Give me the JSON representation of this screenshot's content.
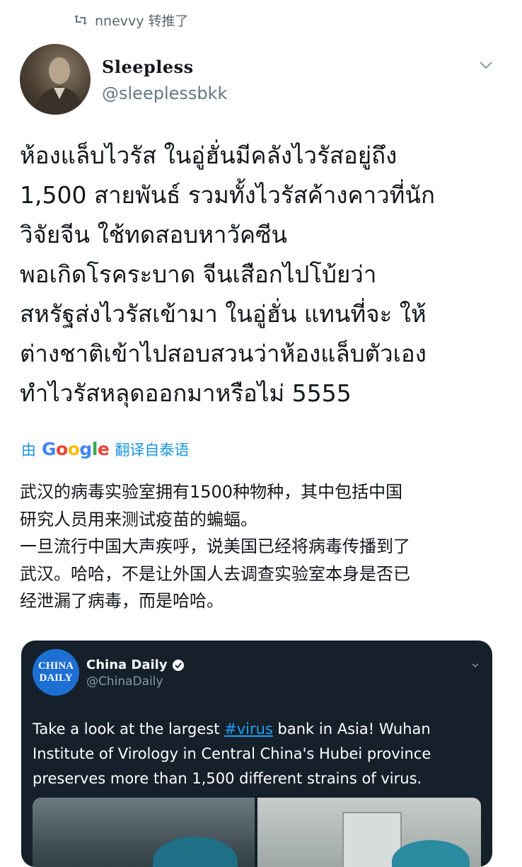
{
  "retweet": {
    "text": "nnevvy 转推了",
    "icon": "retweet-icon"
  },
  "tweet": {
    "display_name": "Sleepless",
    "handle": "@sleeplessbkk",
    "thai_lines": [
      "ห้องแล็บไวรัส ในอู่ฮั่นมีคลังไวรัสอยู่ถึง",
      "1,500 สายพันธ์ รวมทั้งไวรัสค้างคาวที่นัก",
      "วิจัยจีน ใช้ทดสอบหาวัคซีน",
      "พอเกิดโรคระบาด จีนเสือกไปโบ้ยว่า",
      "สหรัฐส่งไวรัสเข้ามา ในอู่ฮั่น แทนที่จะ ให้",
      "ต่างชาติเข้าไปสอบสวนว่าห้องแล็บตัวเอง",
      "ทำไวรัสหลุดออกมาหรือไม่ 5555"
    ],
    "translate": {
      "by": "由",
      "google": "Google",
      "label": "翻译自泰语"
    },
    "translation_lines": [
      "武汉的病毒实验室拥有1500种物种，其中包括中国",
      "研究人员用来测试疫苗的蝙蝠。",
      "一旦流行中国大声疾呼，说美国已经将病毒传播到了",
      "武汉。哈哈，不是让外国人去调查实验室本身是否已",
      "经泄漏了病毒，而是哈哈。"
    ]
  },
  "quoted": {
    "logo_top": "CHINA",
    "logo_bottom": "DAILY",
    "name": "China Daily",
    "handle": "@ChinaDaily",
    "line1_pre": "Take a look at the largest ",
    "hashtag": "#virus",
    "line1_post": " bank in Asia! Wuhan",
    "line2": "Institute of Virology in Central China's Hubei province",
    "line3": "preserves more than 1,500 different strains of virus."
  },
  "colors": {
    "link_blue": "#1b95e0",
    "card_bg": "#15202b",
    "logo_blue": "#1d6fd1",
    "hashtag": "#1da1f2",
    "muted": "#657786"
  }
}
